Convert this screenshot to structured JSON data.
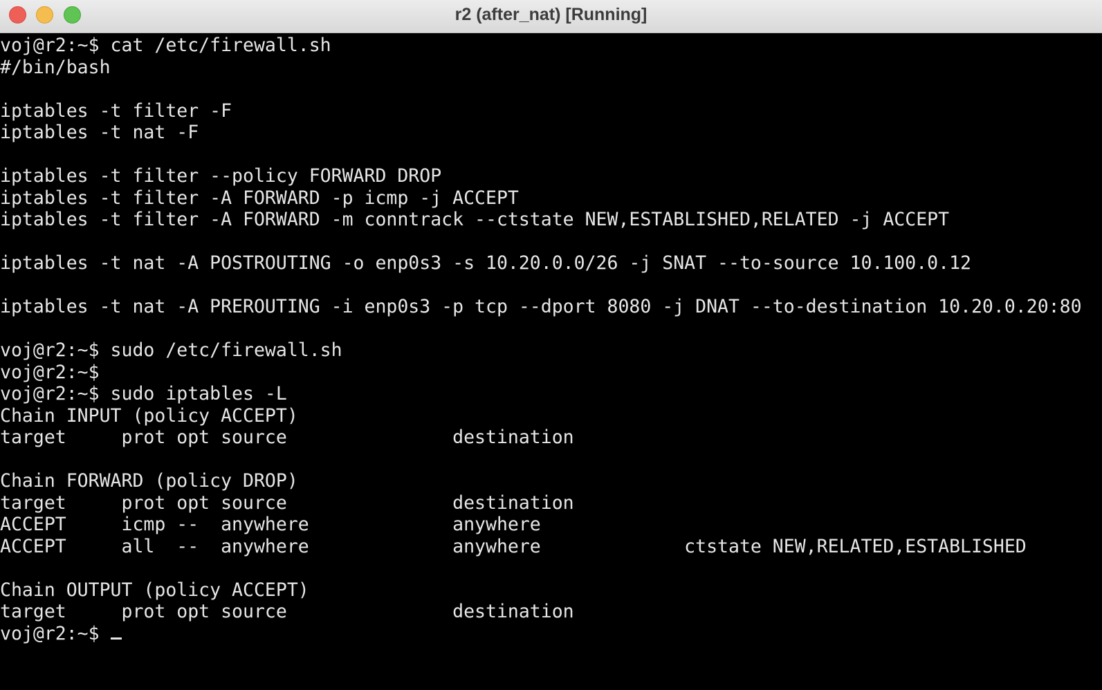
{
  "window": {
    "title": "r2 (after_nat) [Running]"
  },
  "terminal": {
    "lines": [
      "voj@r2:~$ cat /etc/firewall.sh",
      "#/bin/bash",
      "",
      "iptables -t filter -F",
      "iptables -t nat -F",
      "",
      "iptables -t filter --policy FORWARD DROP",
      "iptables -t filter -A FORWARD -p icmp -j ACCEPT",
      "iptables -t filter -A FORWARD -m conntrack --ctstate NEW,ESTABLISHED,RELATED -j ACCEPT",
      "",
      "iptables -t nat -A POSTROUTING -o enp0s3 -s 10.20.0.0/26 -j SNAT --to-source 10.100.0.12",
      "",
      "iptables -t nat -A PREROUTING -i enp0s3 -p tcp --dport 8080 -j DNAT --to-destination 10.20.0.20:80",
      "",
      "voj@r2:~$ sudo /etc/firewall.sh",
      "voj@r2:~$",
      "voj@r2:~$ sudo iptables -L",
      "Chain INPUT (policy ACCEPT)",
      "target     prot opt source               destination",
      "",
      "Chain FORWARD (policy DROP)",
      "target     prot opt source               destination",
      "ACCEPT     icmp --  anywhere             anywhere",
      "ACCEPT     all  --  anywhere             anywhere             ctstate NEW,RELATED,ESTABLISHED",
      "",
      "Chain OUTPUT (policy ACCEPT)",
      "target     prot opt source               destination",
      "voj@r2:~$ "
    ]
  }
}
